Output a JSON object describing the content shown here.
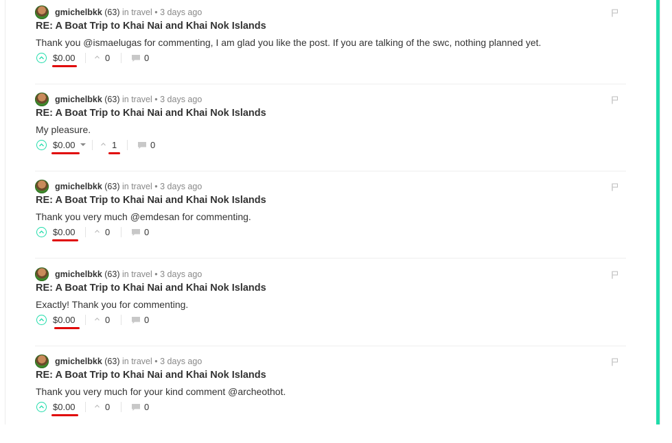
{
  "comments": [
    {
      "author": "gmichelbkk",
      "reputation": "(63)",
      "in_label": "in",
      "category": "travel",
      "time": "• 3 days ago",
      "title": "RE: A Boat Trip to Khai Nai and Khai Nok Islands",
      "body": "Thank you @ismaelugas for commenting, I am glad you like the post. If you are talking of the swc, nothing planned yet.",
      "payout": "$0.00",
      "votes": "0",
      "replies": "0"
    },
    {
      "author": "gmichelbkk",
      "reputation": "(63)",
      "in_label": "in",
      "category": "travel",
      "time": "• 3 days ago",
      "title": "RE: A Boat Trip to Khai Nai and Khai Nok Islands",
      "body": "My pleasure.",
      "payout": "$0.00",
      "votes": "1",
      "replies": "0"
    },
    {
      "author": "gmichelbkk",
      "reputation": "(63)",
      "in_label": "in",
      "category": "travel",
      "time": "• 3 days ago",
      "title": "RE: A Boat Trip to Khai Nai and Khai Nok Islands",
      "body": "Thank you very much @emdesan for commenting.",
      "payout": "$0.00",
      "votes": "0",
      "replies": "0"
    },
    {
      "author": "gmichelbkk",
      "reputation": "(63)",
      "in_label": "in",
      "category": "travel",
      "time": "• 3 days ago",
      "title": "RE: A Boat Trip to Khai Nai and Khai Nok Islands",
      "body": "Exactly! Thank you for commenting.",
      "payout": "$0.00",
      "votes": "0",
      "replies": "0"
    },
    {
      "author": "gmichelbkk",
      "reputation": "(63)",
      "in_label": "in",
      "category": "travel",
      "time": "• 3 days ago",
      "title": "RE: A Boat Trip to Khai Nai and Khai Nok Islands",
      "body": "Thank you very much for your kind comment @archeothot.",
      "payout": "$0.00",
      "votes": "0",
      "replies": "0"
    }
  ],
  "colors": {
    "accent": "#1fdcaa",
    "highlight_underline": "#e00000",
    "text": "#333333",
    "muted": "#888888"
  },
  "icons": {
    "upvote": "upvote-circle-icon",
    "votes": "chevron-up-icon",
    "replies": "speech-bubble-icon",
    "flag": "flag-icon",
    "payout_dropdown": "caret-down-icon"
  }
}
